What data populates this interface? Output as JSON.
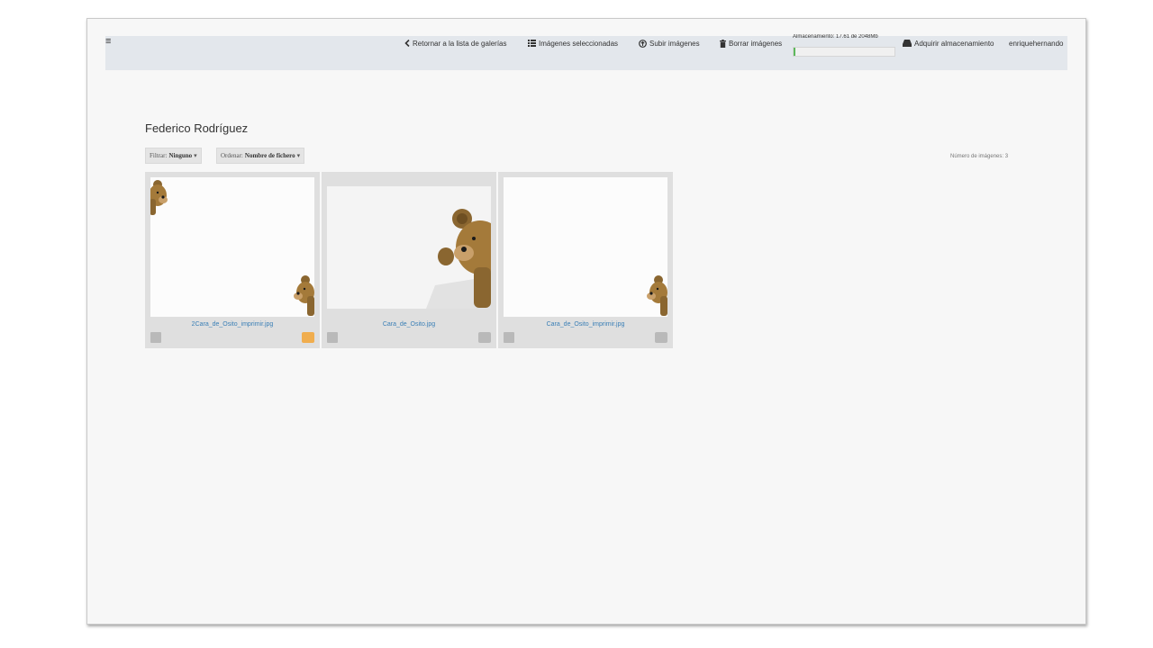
{
  "nav": {
    "back_label": "Retornar a la lista de galerías",
    "selected_label": "Imágenes seleccionadas",
    "upload_label": "Subir imágenes",
    "delete_label": "Borrar imágenes",
    "storage_label": "Almacenamiento: 17.61 de 2048Mb",
    "storage_fraction": 0.009,
    "buy_label": "Adquirir almacenamiento",
    "user_label": "enriquehernando"
  },
  "gallery": {
    "title": "Federico Rodríguez",
    "filter_label": "Filtrar:",
    "filter_value": "Ninguno",
    "order_label": "Ordenar:",
    "order_value": "Nombre de fichero",
    "count_text": "Número de imágenes: 3"
  },
  "images": [
    {
      "filename": "2Cara_de_Osito_imprimir.jpg",
      "has_comment": true
    },
    {
      "filename": "Cara_de_Osito.jpg",
      "has_comment": false
    },
    {
      "filename": "Cara_de_Osito_imprimir.jpg",
      "has_comment": false
    }
  ],
  "colors": {
    "topbar": "#e3e7ec",
    "link": "#3a7fb6",
    "storage_fill": "#5cb85c",
    "comment_active": "#f0ad4e",
    "comment_inactive": "#b9b9b9"
  }
}
